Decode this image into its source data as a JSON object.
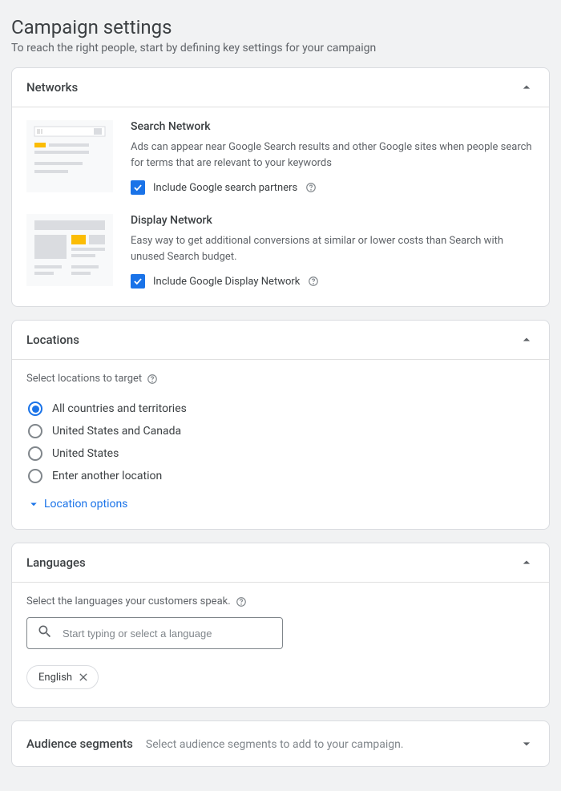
{
  "header": {
    "title": "Campaign settings",
    "subtitle": "To reach the right people, start by defining key settings for your campaign"
  },
  "networks": {
    "title": "Networks",
    "search": {
      "title": "Search Network",
      "desc": "Ads can appear near Google Search results and other Google sites when people search for terms that are relevant to your keywords",
      "checkbox_label": "Include Google search partners",
      "checked": true
    },
    "display": {
      "title": "Display Network",
      "desc": "Easy way to get additional conversions at similar or lower costs than Search with unused Search budget.",
      "checkbox_label": "Include Google Display Network",
      "checked": true
    }
  },
  "locations": {
    "title": "Locations",
    "instruction": "Select locations to target",
    "options": {
      "all": "All countries and territories",
      "us_ca": "United States and Canada",
      "us": "United States",
      "other": "Enter another location"
    },
    "selected": "all",
    "expand_label": "Location options"
  },
  "languages": {
    "title": "Languages",
    "instruction": "Select the languages your customers speak.",
    "placeholder": "Start typing or select a language",
    "chip": "English"
  },
  "audience": {
    "title": "Audience segments",
    "subtitle": "Select audience segments to add to your campaign."
  }
}
